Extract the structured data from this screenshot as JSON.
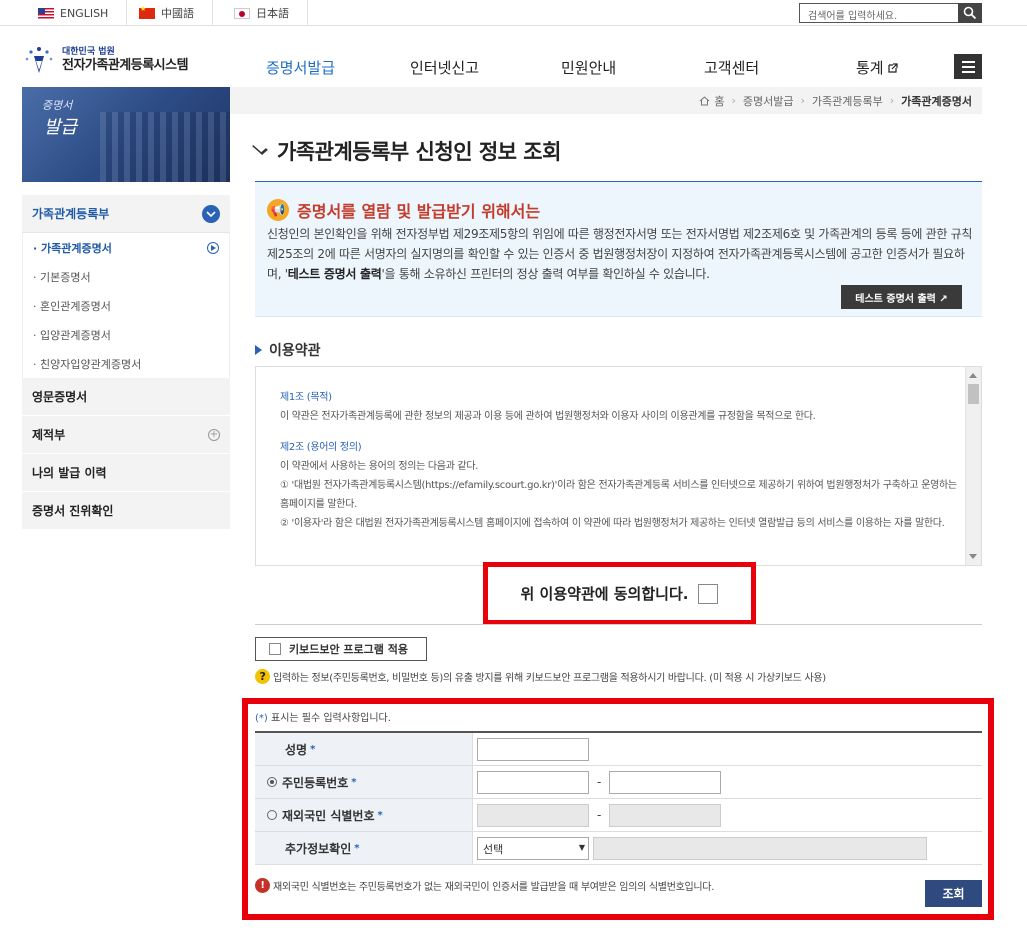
{
  "topbar": {
    "languages": [
      {
        "label": "ENGLISH",
        "flag": "us-flag-icon"
      },
      {
        "label": "中國語",
        "flag": "cn-flag-icon"
      },
      {
        "label": "日本語",
        "flag": "jp-flag-icon"
      }
    ],
    "search_placeholder": "검색어를 입력하세요."
  },
  "header": {
    "logo_small": "대한민국 법원",
    "logo_big": "전자가족관계등록시스템",
    "nav": [
      "증명서발급",
      "인터넷신고",
      "민원안내",
      "고객센터",
      "통계"
    ],
    "active_nav": "증명서발급",
    "accent": "#1c6ec4"
  },
  "sidebar": {
    "banner_line1": "증명서",
    "banner_line2": "발급",
    "section_head": "가족관계등록부",
    "sub_items": [
      "· 가족관계증명서",
      "· 기본증명서",
      "· 혼인관계증명서",
      "· 입양관계증명서",
      "· 친양자입양관계증명서"
    ],
    "categories": [
      "영문증명서",
      "제적부",
      "나의 발급 이력",
      "증명서 진위확인"
    ]
  },
  "breadcrumb": {
    "home": "홈",
    "items": [
      "증명서발급",
      "가족관계등록부",
      "가족관계증명서"
    ]
  },
  "page": {
    "title": "가족관계등록부 신청인 정보 조회"
  },
  "notice": {
    "heading": "증명서를 열람 및 발급받기 위해서는",
    "body_pre": "신청인의 본인확인을 위해 전자정부법 제29조제5항의 위임에 따른 행정전자서명 또는 전자서명법 제2조제6호 및 가족관계의 등록 등에 관한 규칙 제25조의 2에 따른 서명자의 실지명의를 확인할 수 있는 인증서 중 법원행정처장이 지정하여 전자가족관계등록시스템에 공고한 인증서가 필요하며, '",
    "body_bold": "테스트 증명서 출력",
    "body_post": "'을 통해 소유하신 프린터의 정상 출력 여부를 확인하실 수 있습니다.",
    "test_button": "테스트 증명서 출력 ↗"
  },
  "terms": {
    "section_title": "이용약관",
    "art1_title": "제1조 (목적)",
    "art1_body": "이 약관은 전자가족관계등록에 관한 정보의 제공과 이용 등에 관하여 법원행정처와 이용자 사이의 이용관계를 규정함을 목적으로 한다.",
    "art2_title": "제2조 (용어의 정의)",
    "art2_body0": "이 약관에서 사용하는 용어의 정의는 다음과 같다.",
    "art2_body1": "① '대법원 전자가족관계등록시스템(https://efamily.scourt.go.kr)'이라 함은 전자가족관계등록 서비스를 인터넷으로 제공하기 위하여 법원행정처가 구축하고 운영하는 홈페이지를 말한다.",
    "art2_body2": "② '이용자'라 함은 대법원 전자가족관계등록시스템 홈페이지에 접속하여 이 약관에 따라 법원행정처가 제공하는 인터넷 열람발급 등의 서비스를 이용하는 자를 말한다.",
    "agree_text": "위 이용약관에 동의합니다."
  },
  "security": {
    "keyboard_button": "키보드보안 프로그램 적용",
    "note": "입력하는 정보(주민등록번호, 비밀번호 등)의 유출 방지를 위해 키보드보안 프로그램을 적용하시기 바랍니다. (미 적용 시 가상키보드 사용)"
  },
  "form": {
    "required_note_star": "(*)",
    "required_note": " 표시는 필수 입력사항입니다.",
    "name_label": "성명",
    "rrn_label": "주민등록번호",
    "foreign_label": "재외국민 식별번호",
    "extra_label": "추가정보확인",
    "star": "*",
    "dash": "-",
    "select_value": "선택",
    "foreign_note": "재외국민 식별번호는 주민등록번호가 없는 재외국민이 인증서를 발급받을 때 부여받은 임의의 식별번호입니다.",
    "submit": "조회"
  },
  "colors": {
    "highlight": "#e8000b",
    "primary": "#2a62b5"
  }
}
